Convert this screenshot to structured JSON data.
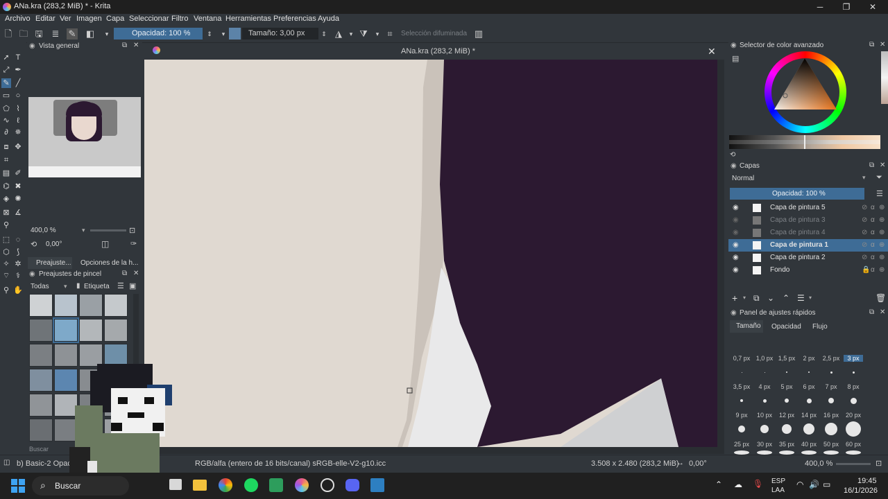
{
  "window": {
    "title": "ANa.kra (283,2 MiB) * - Krita",
    "controls": {
      "minimize": "─",
      "maximize": "❐",
      "close": "✕"
    }
  },
  "menu": [
    "Archivo",
    "Editar",
    "Ver",
    "Imagen",
    "Capa",
    "Seleccionar",
    "Filtro",
    "Ventana",
    "Herramientas",
    "Preferencias",
    "Ayuda"
  ],
  "toolbar": {
    "opacity": "Opacidad: 100 %",
    "size": "Tamaño: 3,00 px",
    "selection_mode": "Selección difuminada"
  },
  "overview": {
    "title": "Vista general",
    "zoom": "400,0 %",
    "rotation": "0,00°"
  },
  "tabs_left": {
    "presets": "Preajuste...",
    "tool_options": "Opciones de la h..."
  },
  "brush_presets": {
    "title": "Preajustes de pincel",
    "filter": "Todas",
    "tag": "Etiqueta",
    "search_placeholder": "Buscar"
  },
  "canvas": {
    "tab_title": "ANa.kra (283,2 MiB) *"
  },
  "color_selector": {
    "title": "Selector de color avanzado"
  },
  "layers": {
    "title": "Capas",
    "blend_mode": "Normal",
    "opacity": "Opacidad:  100 %",
    "items": [
      {
        "name": "Capa de pintura 5",
        "visible": true
      },
      {
        "name": "Capa de pintura 3",
        "visible": false
      },
      {
        "name": "Capa de pintura 4",
        "visible": false
      },
      {
        "name": "Capa de pintura 1",
        "visible": true,
        "active": true
      },
      {
        "name": "Capa de pintura 2",
        "visible": true
      },
      {
        "name": "Fondo",
        "visible": true,
        "locked": true
      }
    ]
  },
  "quick_settings": {
    "title": "Panel de ajustes rápidos",
    "tabs": [
      "Tamaño",
      "Opacidad",
      "Flujo"
    ],
    "sizes": [
      "0,7 px",
      "1,0 px",
      "1,5 px",
      "2 px",
      "2,5 px",
      "3 px",
      "3,5 px",
      "4 px",
      "5 px",
      "6 px",
      "7 px",
      "8 px",
      "9 px",
      "10 px",
      "12 px",
      "14 px",
      "16 px",
      "20 px",
      "25 px",
      "30 px",
      "35 px",
      "40 px",
      "50 px",
      "60 px"
    ],
    "selected_size": "3 px"
  },
  "status": {
    "brush": "b) Basic-2 Opacit",
    "color_profile": "RGB/alfa (entero de 16 bits/canal)  sRGB-elle-V2-g10.icc",
    "dimensions": "3.508 x 2.480 (283,2 MiB)",
    "rotation": "0,00°",
    "zoom": "400,0 %"
  },
  "taskbar": {
    "search": "Buscar",
    "lang": "ESP",
    "lang2": "LAA",
    "time": "19:45",
    "date": "16/1/2026"
  },
  "colors": {
    "accent": "#3e6c96",
    "panel": "#31363b",
    "hair": "#2c1931",
    "canvas_bg": "#e0d9d1"
  }
}
